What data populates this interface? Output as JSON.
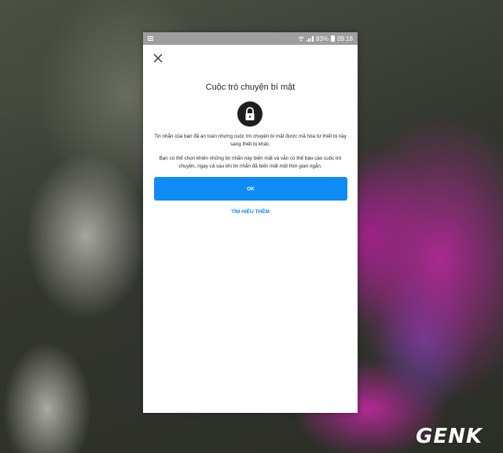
{
  "status_bar": {
    "battery": "83%",
    "time": "09:18",
    "icons": [
      "image-icon",
      "wifi-icon",
      "signal-icon",
      "battery-icon"
    ]
  },
  "dialog": {
    "close_icon": "close-icon",
    "title": "Cuộc trò chuyện bí mật",
    "lock_icon": "lock-icon",
    "description_1": "Tin nhắn của bạn đã an toàn nhưng cuộc trò chuyện bí mật được mã hóa từ thiết bị này sang thiết bị khác.",
    "description_2": "Bạn có thể chọn khiến những tin nhắn này biến mất và vẫn có thể báo cáo cuộc trò chuyện, ngay cả sau khi tin nhắn đã biến mất một thời gian ngắn.",
    "ok_label": "OK",
    "learn_more_label": "TÌM HIỂU THÊM"
  },
  "watermark": "GENK",
  "colors": {
    "accent": "#0f8bf5",
    "status_bar": "#9e9e9e",
    "lock_circle": "#1f1f1f"
  }
}
